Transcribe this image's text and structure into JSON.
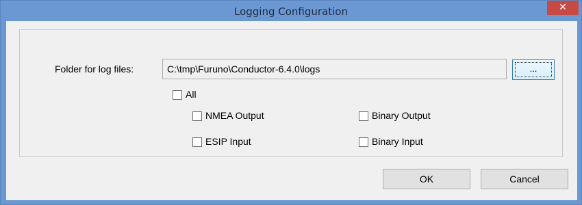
{
  "window": {
    "title": "Logging Configuration",
    "close_glyph": "✕"
  },
  "form": {
    "folder_label": "Folder for log files:",
    "folder_value": "C:\\tmp\\Furuno\\Conductor-6.4.0\\logs",
    "browse_label": "...",
    "all_label": "All",
    "all_checked": false,
    "options": [
      {
        "label": "NMEA Output",
        "checked": false
      },
      {
        "label": "Binary Output",
        "checked": false
      },
      {
        "label": "ESIP Input",
        "checked": false
      },
      {
        "label": "Binary Input",
        "checked": false
      }
    ]
  },
  "buttons": {
    "ok": "OK",
    "cancel": "Cancel"
  },
  "colors": {
    "titlebar": "#6b98d3",
    "close": "#c74b44",
    "client": "#f0f0f0"
  }
}
